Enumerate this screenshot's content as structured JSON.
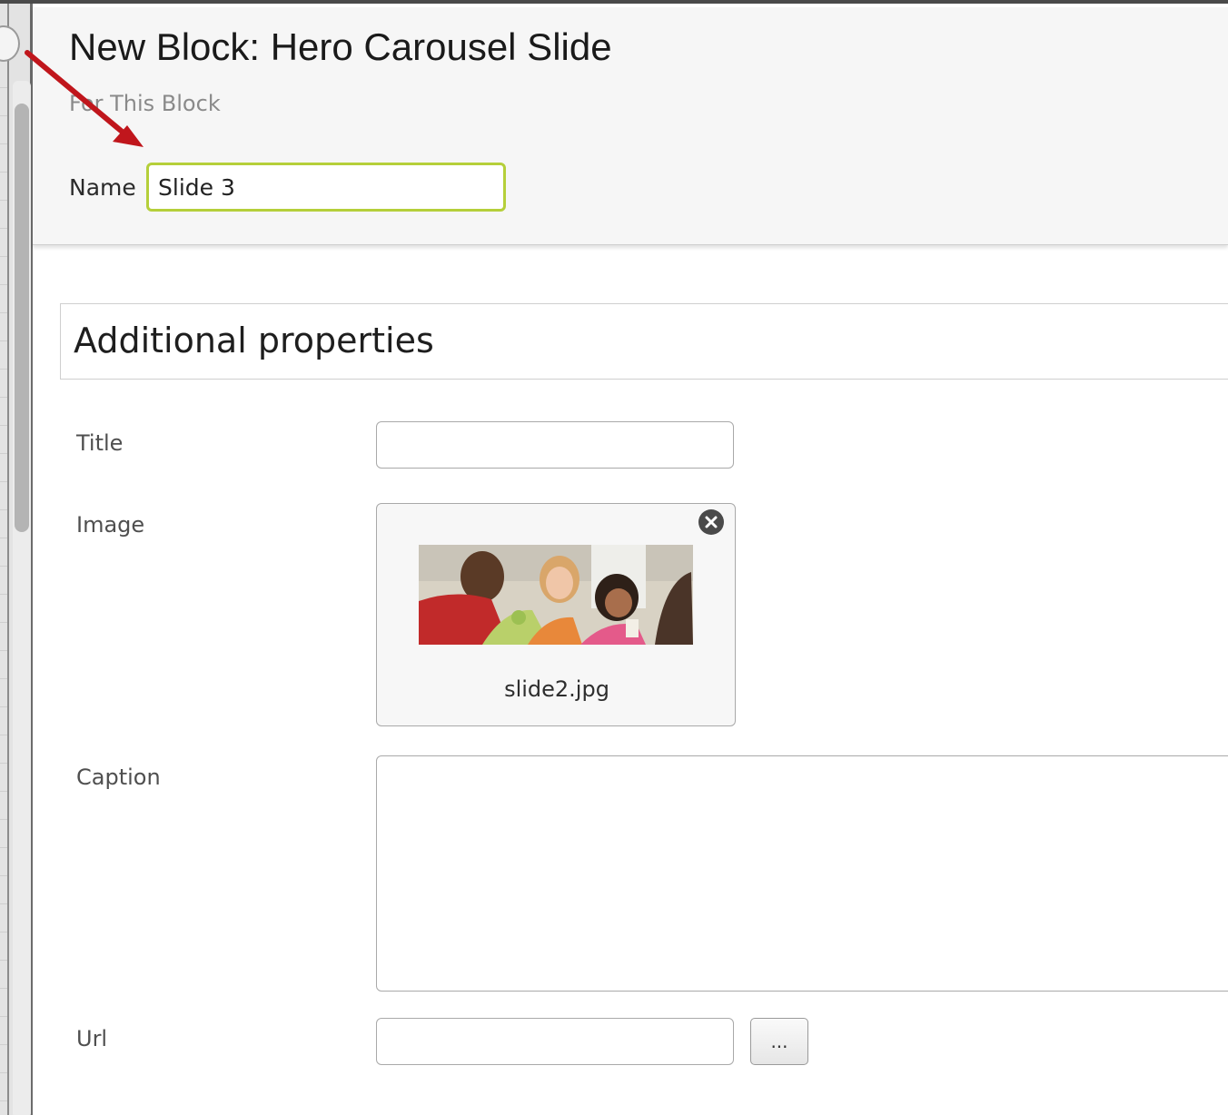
{
  "header": {
    "title": "New Block: Hero Carousel Slide",
    "subtitle": "For This Block",
    "name_label": "Name",
    "name_value": "Slide 3"
  },
  "section": {
    "title": "Additional properties"
  },
  "fields": {
    "title": {
      "label": "Title",
      "value": ""
    },
    "image": {
      "label": "Image",
      "file_name": "slide2.jpg"
    },
    "caption": {
      "label": "Caption",
      "value": ""
    },
    "url": {
      "label": "Url",
      "value": "",
      "browse_label": "..."
    }
  },
  "colors": {
    "focus_border": "#b5cf3a",
    "annotation_arrow": "#c0161c"
  },
  "icons": {
    "remove": "close-circle-icon",
    "annotation": "arrow-annotation"
  }
}
